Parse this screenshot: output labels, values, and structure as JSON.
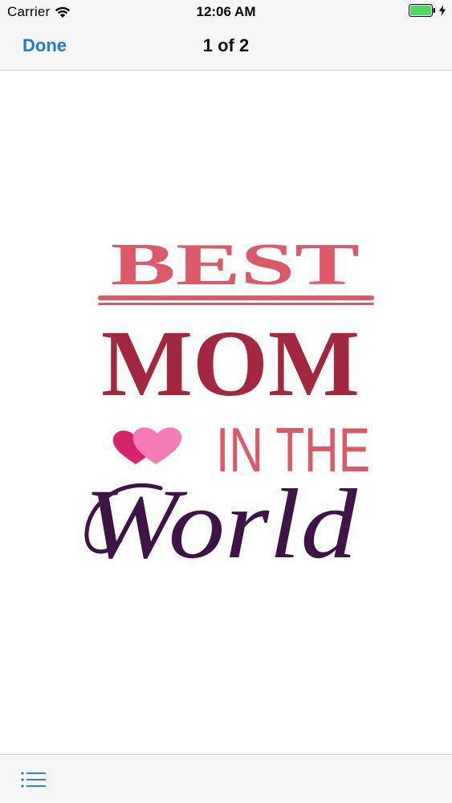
{
  "status_bar": {
    "carrier": "Carrier",
    "time": "12:06 AM",
    "battery_color": "#4cd964",
    "icons": [
      "wifi-icon",
      "battery-icon",
      "charging-bolt-icon"
    ]
  },
  "nav": {
    "done_label": "Done",
    "title": "1 of 2",
    "accent_color": "#1f78d1"
  },
  "artwork": {
    "line1": "BEST",
    "line2": "MOM",
    "line3": "IN THE",
    "line4": "World",
    "colors": {
      "best": "#dc5a68",
      "mom": "#a3283f",
      "in_the": "#dc5a68",
      "world": "#3d1445",
      "heart_dark": "#d6246a",
      "heart_light": "#f47bb4"
    }
  },
  "toolbar": {
    "icons": [
      "list-icon"
    ]
  }
}
